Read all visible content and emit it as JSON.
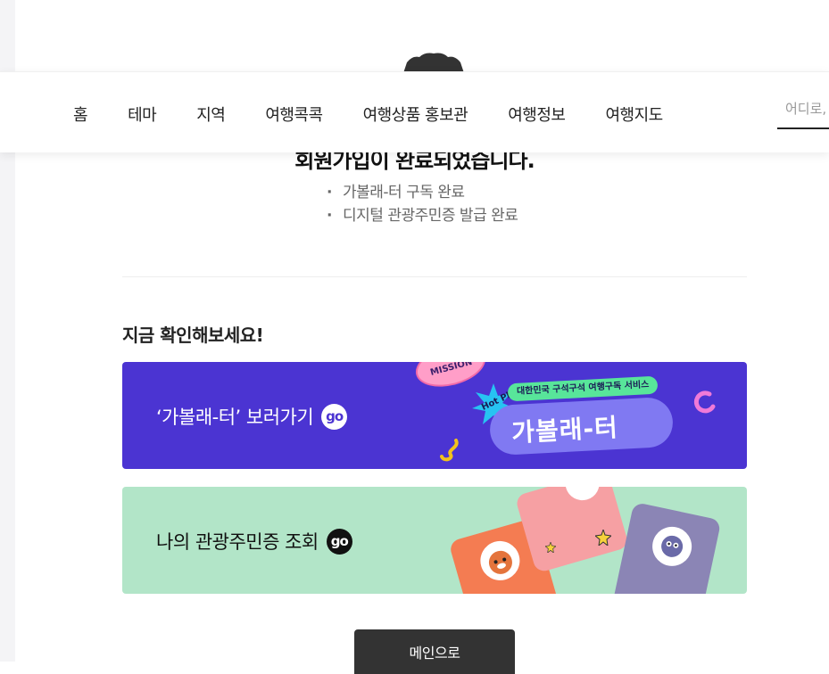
{
  "nav": {
    "items": [
      "홈",
      "테마",
      "지역",
      "여행콕콕",
      "여행상품 홍보관",
      "여행정보",
      "여행지도"
    ],
    "search_placeholder": "어디로,"
  },
  "completion": {
    "title": "회원가입이 완료되었습니다.",
    "bullets": [
      "가볼래-터 구독 완료",
      "디지털 관광주민증 발급 완료"
    ]
  },
  "section": {
    "heading": "지금 확인해보세요!"
  },
  "banners": {
    "garbolaeter": {
      "label": "‘가볼래-터’ 보러가기",
      "go": "go",
      "mission": "MISSION",
      "hot_place": "Hot Place",
      "tag": "대한민국 구석구석 여행구독 서비스",
      "logo": "가볼래-터",
      "bg_color": "#4b34d2"
    },
    "resident_card": {
      "label": "나의 관광주민증 조회",
      "go": "go",
      "bg_color": "#b2e5c8"
    }
  },
  "footer": {
    "main_button": "메인으로"
  }
}
